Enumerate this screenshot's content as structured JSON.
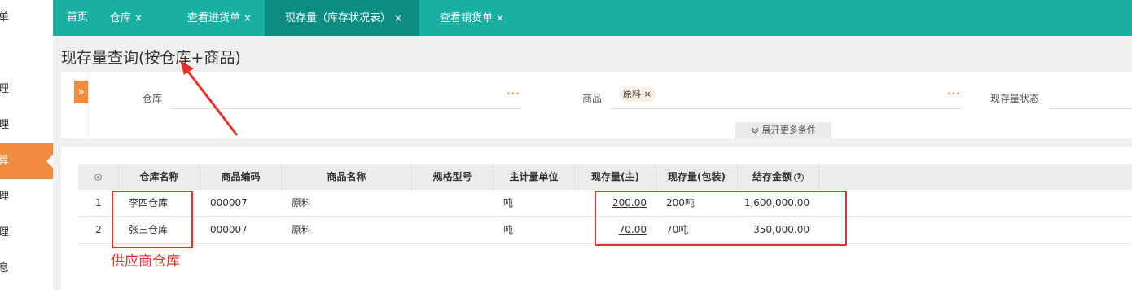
{
  "sidebar": {
    "items": [
      {
        "label": "单",
        "active": false
      },
      {
        "label": "理",
        "active": false
      },
      {
        "label": "理",
        "active": false
      },
      {
        "label": "算",
        "active": true
      },
      {
        "label": "理",
        "active": false
      },
      {
        "label": "理",
        "active": false
      },
      {
        "label": "息",
        "active": false
      }
    ]
  },
  "tabs": [
    {
      "label": "首页",
      "closable": false
    },
    {
      "label": "仓库",
      "closable": true
    },
    {
      "label": "查看进货单",
      "closable": true
    },
    {
      "label": "现存量（库存状况表）",
      "closable": true,
      "active": true
    },
    {
      "label": "查看销货单",
      "closable": true
    }
  ],
  "tab_close_glyph": "×",
  "page_title": "现存量查询(按仓库+商品)",
  "filters": {
    "expand_glyph": "»",
    "warehouse_label": "仓库",
    "product_label": "商品",
    "product_chip": "原料",
    "chip_close": "×",
    "status_label": "现存量状态",
    "dots": "···",
    "more_conditions": "展开更多条件",
    "more_icon": "chevrons-down-icon"
  },
  "table": {
    "settings_icon": "gear-icon",
    "columns": [
      "仓库名称",
      "商品编码",
      "商品名称",
      "规格型号",
      "主计量单位",
      "现存量(主)",
      "现存量(包装)",
      "结存金额"
    ],
    "help_glyph": "?",
    "rows": [
      {
        "index": "1",
        "warehouse": "李四仓库",
        "code": "000007",
        "name": "原料",
        "spec": "",
        "unit": "吨",
        "qty_main": "200.00",
        "qty_pack": "200吨",
        "amount": "1,600,000.00"
      },
      {
        "index": "2",
        "warehouse": "张三仓库",
        "code": "000007",
        "name": "原料",
        "spec": "",
        "unit": "吨",
        "qty_main": "70.00",
        "qty_pack": "70吨",
        "amount": "350,000.00"
      }
    ]
  },
  "annotation": {
    "text": "供应商仓库",
    "color": "#e8312a"
  },
  "colors": {
    "topbar": "#1aafa3",
    "active_tab": "#0d8d82",
    "accent": "#f08a3c"
  }
}
